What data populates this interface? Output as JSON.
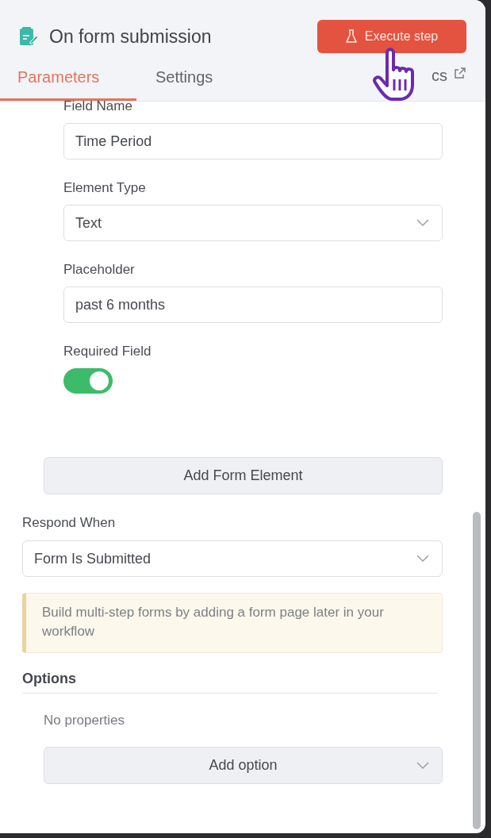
{
  "header": {
    "title": "On form submission",
    "execute_button": "Execute step"
  },
  "tabs": [
    {
      "label": "Parameters",
      "selected": true,
      "kind": "plain"
    },
    {
      "label": "Settings",
      "selected": false,
      "kind": "plain"
    },
    {
      "label": "cs",
      "selected": false,
      "kind": "external"
    }
  ],
  "form_element": {
    "fields": [
      {
        "kind": "input",
        "label": "Field Name",
        "value": "Time Period"
      },
      {
        "kind": "select",
        "label": "Element Type",
        "value": "Text"
      },
      {
        "kind": "input",
        "label": "Placeholder",
        "value": "past 6 months"
      },
      {
        "kind": "toggle",
        "label": "Required Field",
        "on": true
      }
    ]
  },
  "add_element_button": "Add Form Element",
  "respond_when": {
    "label": "Respond When",
    "value": "Form Is Submitted"
  },
  "notice": "Build multi-step forms by adding a form page later in your workflow",
  "options": {
    "title": "Options",
    "empty_text": "No properties",
    "add_button": "Add option"
  }
}
